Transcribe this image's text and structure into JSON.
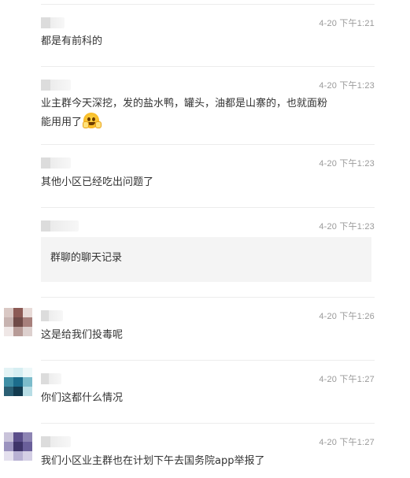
{
  "comments": [
    {
      "author": "",
      "time": "4-20 下午1:21",
      "text": "都是有前科的"
    },
    {
      "author": "",
      "time": "4-20 下午1:23",
      "text": "业主群今天深挖，发的盐水鸭，罐头，油都是山寨的，也就面粉",
      "text2": "能用用了",
      "emoji": "grinning-sweat-emoji"
    },
    {
      "author": "",
      "time": "4-20 下午1:23",
      "text": "其他小区已经吃出问题了"
    },
    {
      "author": "",
      "time": "4-20 下午1:23",
      "quote": "群聊的聊天记录"
    },
    {
      "author": "",
      "time": "4-20 下午1:26",
      "text": "这是给我们投毒呢"
    },
    {
      "author": "",
      "time": "4-20 下午1:27",
      "text": "你们这都什么情况"
    },
    {
      "author": "",
      "time": "4-20 下午1:27",
      "text": "我们小区业主群也在计划下午去国务院app举报了"
    }
  ]
}
